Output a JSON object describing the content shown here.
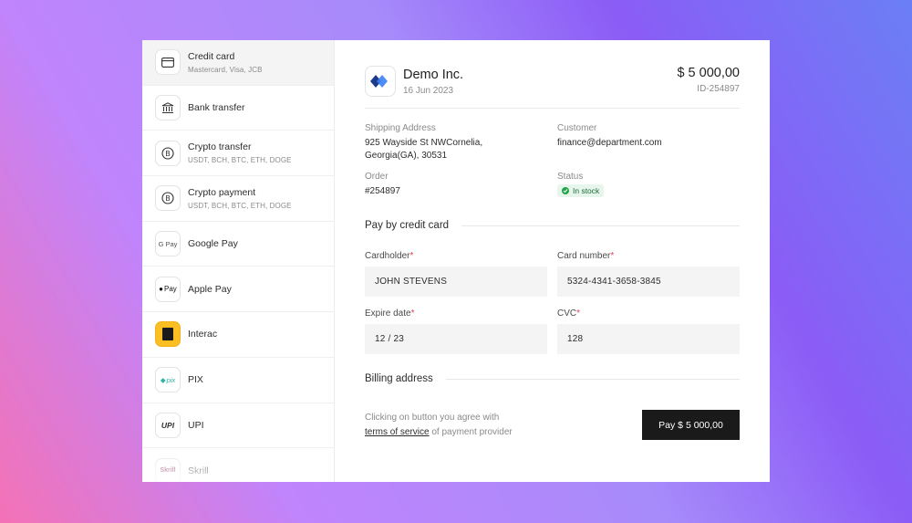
{
  "sidebar": {
    "items": [
      {
        "name": "Credit card",
        "sub": "Mastercard, Visa, JCB",
        "icon": "credit-card-icon",
        "active": true
      },
      {
        "name": "Bank transfer",
        "sub": "",
        "icon": "bank-icon"
      },
      {
        "name": "Crypto transfer",
        "sub": "USDT, BCH, BTC, ETH, DOGE",
        "icon": "bitcoin-icon"
      },
      {
        "name": "Crypto payment",
        "sub": "USDT, BCH, BTC, ETH, DOGE",
        "icon": "bitcoin-icon"
      },
      {
        "name": "Google Pay",
        "sub": "",
        "icon": "google-pay-icon",
        "icon_text": "G Pay"
      },
      {
        "name": "Apple Pay",
        "sub": "",
        "icon": "apple-pay-icon",
        "icon_text": "Pay"
      },
      {
        "name": "Interac",
        "sub": "",
        "icon": "interac-icon"
      },
      {
        "name": "PIX",
        "sub": "",
        "icon": "pix-icon",
        "icon_text": "pix"
      },
      {
        "name": "UPI",
        "sub": "",
        "icon": "upi-icon",
        "icon_text": "UPI"
      },
      {
        "name": "Skrill",
        "sub": "",
        "icon": "skrill-icon",
        "icon_text": "Skrill"
      }
    ]
  },
  "header": {
    "company": "Demo Inc.",
    "date": "16 Jun 2023",
    "amount": "$ 5 000,00",
    "id": "ID-254897"
  },
  "info": {
    "shipping_label": "Shipping Address",
    "shipping_line1": "925 Wayside St NWCornelia,",
    "shipping_line2": "Georgia(GA), 30531",
    "customer_label": "Customer",
    "customer_value": "finance@department.com",
    "order_label": "Order",
    "order_value": "#254897",
    "status_label": "Status",
    "status_value": "In stock"
  },
  "payment": {
    "section_title": "Pay by credit card",
    "cardholder_label": "Cardholder",
    "cardholder_value": "JOHN STEVENS",
    "card_number_label": "Card number",
    "card_number_value": "5324-4341-3658-3845",
    "expire_label": "Expire date",
    "expire_value": "12 / 23",
    "cvc_label": "CVC",
    "cvc_value": "128",
    "required_mark": "*"
  },
  "billing": {
    "title": "Billing address"
  },
  "footer": {
    "agree_text": "Clicking on button you agree with",
    "terms_link": "terms of service",
    "terms_suffix": " of payment provider",
    "pay_button": "Pay $ 5 000,00"
  },
  "colors": {
    "accent_dark": "#1a1a1a",
    "status_green": "#22a54a",
    "required_red": "#e0455a",
    "logo_blue": "#2f6fd6",
    "logo_navy": "#1e3a8a"
  }
}
